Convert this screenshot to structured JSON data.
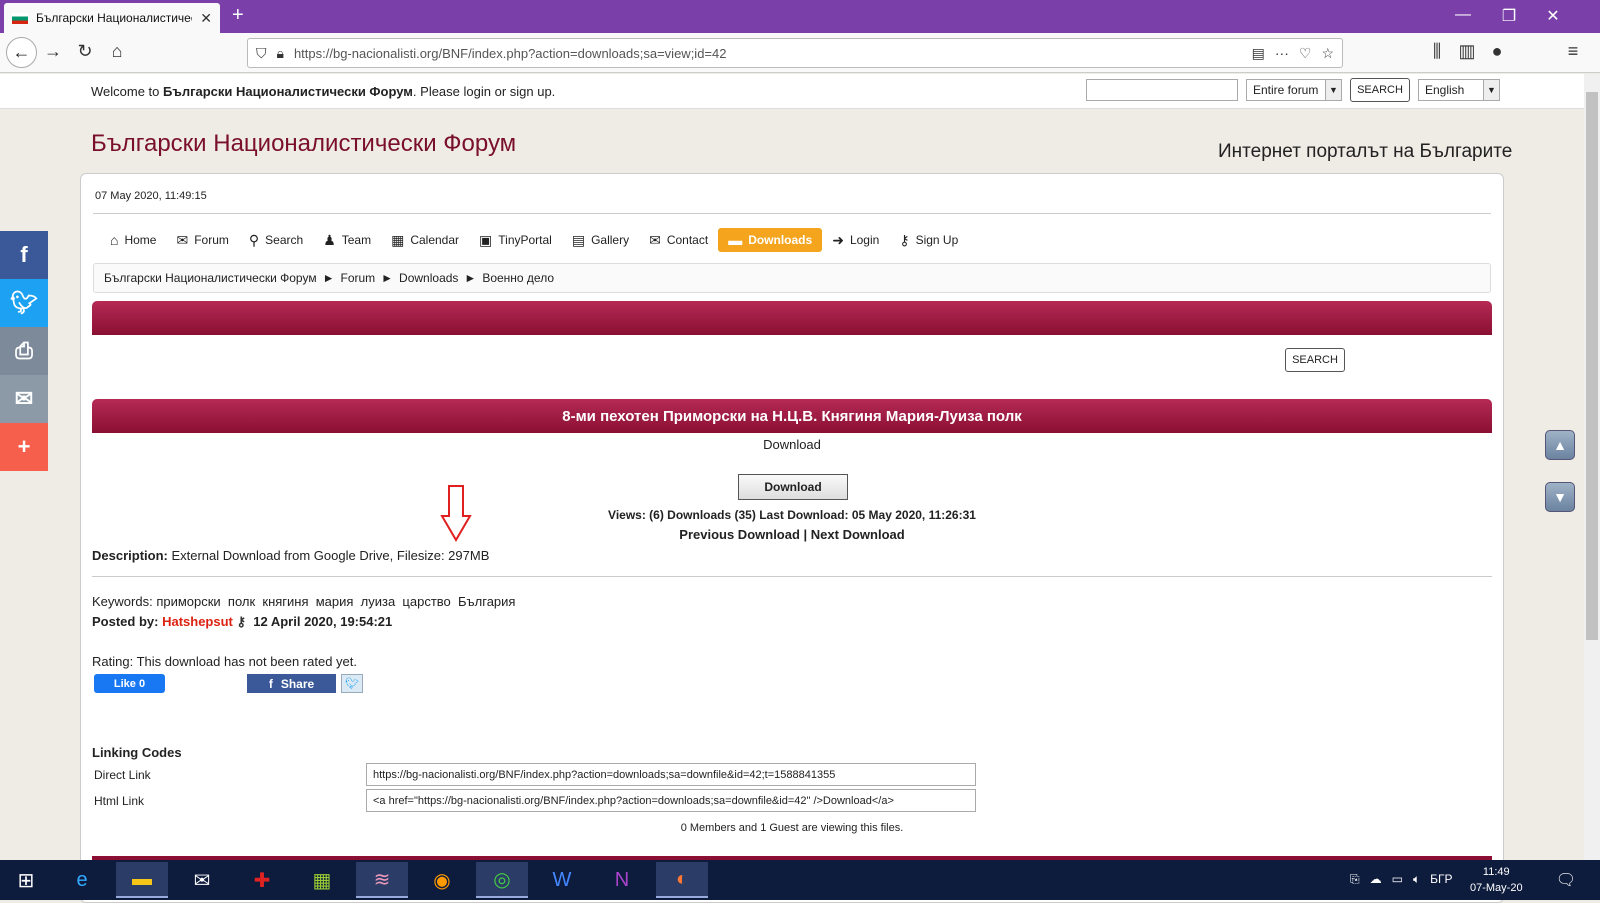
{
  "browser": {
    "tab_title": "Български Националистически Форум",
    "url": "https://bg-nacionalisti.org/BNF/index.php?action=downloads;sa=view;id=42"
  },
  "top": {
    "welcome_prefix": "Welcome to ",
    "welcome_forum": "Български Националистически Форум",
    "welcome_suffix": ". Please login or sign up.",
    "scope": "Entire forum",
    "search_label": "SEARCH",
    "language": "English"
  },
  "site": {
    "title": "Български Националистически Форум",
    "tagline": "Интернет порталът на Българите",
    "date": "07 May 2020, 11:49:15"
  },
  "menu": [
    {
      "label": "Home",
      "icon": "⌂"
    },
    {
      "label": "Forum",
      "icon": "✉"
    },
    {
      "label": "Search",
      "icon": "⚲"
    },
    {
      "label": "Team",
      "icon": "♟"
    },
    {
      "label": "Calendar",
      "icon": "▦"
    },
    {
      "label": "TinyPortal",
      "icon": "▣"
    },
    {
      "label": "Gallery",
      "icon": "▤"
    },
    {
      "label": "Contact",
      "icon": "✉"
    },
    {
      "label": "Downloads",
      "icon": "▬"
    },
    {
      "label": "Login",
      "icon": "➜"
    },
    {
      "label": "Sign Up",
      "icon": "⚷"
    }
  ],
  "breadcrumb": [
    "Български Националистически Форум",
    "Forum",
    "Downloads",
    "Военно дело"
  ],
  "breadcrumb_sep": "►",
  "search_button": "SEARCH",
  "download": {
    "title": "8-ми пехотен Приморски на Н.Ц.В. Княгиня Мария-Луиза полк",
    "label": "Download",
    "button": "Download",
    "stats": "Views: (6)  Downloads (35)  Last Download: 05 May 2020, 11:26:31",
    "prev": "Previous Download",
    "next": "Next Download",
    "desc_label": "Description:",
    "desc_text": " External Download from Google Drive, Filesize: 297MB",
    "keywords_label": "Keywords: ",
    "keywords": "приморски  полк  княгиня  мария  луиза  царство  България",
    "posted_label": "Posted by: ",
    "posted_user": "Hatshepsut",
    "posted_date": "12 April 2020, 19:54:21",
    "rating": "Rating: This download has not been rated yet."
  },
  "social": {
    "like": "Like 0",
    "share": "Share"
  },
  "linking": {
    "title": "Linking Codes",
    "direct_label": "Direct Link",
    "direct": "https://bg-nacionalisti.org/BNF/index.php?action=downloads;sa=downfile&id=42;t=1588841355",
    "html_label": "Html Link",
    "html": "<a href=\"https://bg-nacionalisti.org/BNF/index.php?action=downloads;sa=downfile&id=42\" />Download</a>",
    "viewing": "0 Members and 1 Guest are viewing this files."
  },
  "taskbar": {
    "time": "11:49",
    "date": "07-May-20",
    "lang": "БГР"
  },
  "colors": {
    "accent": "#8a0f33",
    "menu_active": "#f5a51d",
    "tab_bar": "#7a3fa8"
  }
}
